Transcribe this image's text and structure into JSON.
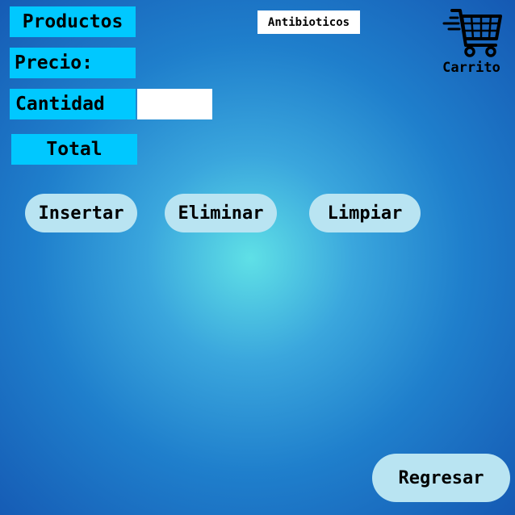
{
  "labels": {
    "productos": "Productos",
    "precio": "Precio:",
    "cantidad": "Cantidad",
    "total": "Total"
  },
  "quantity_input": {
    "value": "",
    "placeholder": ""
  },
  "category": "Antibioticos",
  "cart": {
    "icon": "shopping-cart-icon",
    "label": "Carrito"
  },
  "actions": {
    "insert": "Insertar",
    "delete": "Eliminar",
    "clear": "Limpiar",
    "back": "Regresar"
  },
  "colors": {
    "label_bg": "#00c8ff",
    "button_bg": "#b9e4f2",
    "background_center": "#5fe0e6",
    "background_edge": "#1559b3"
  }
}
